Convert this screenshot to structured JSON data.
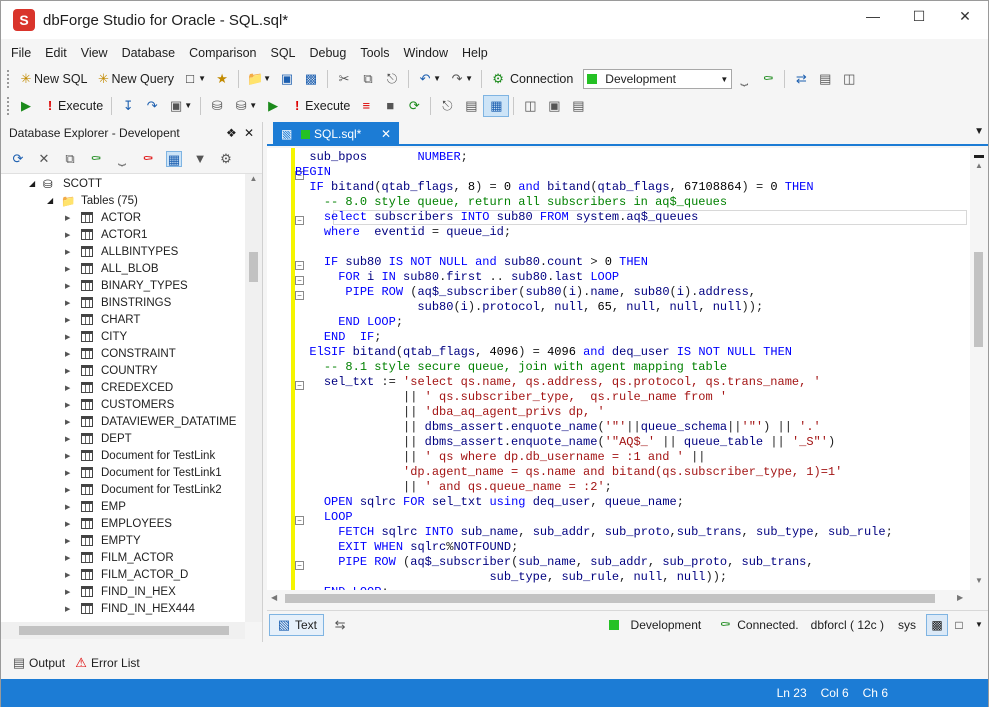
{
  "window": {
    "title": "dbForge Studio for Oracle - SQL.sql*",
    "logo_letter": "S"
  },
  "menu": [
    "File",
    "Edit",
    "View",
    "Database",
    "Comparison",
    "SQL",
    "Debug",
    "Tools",
    "Window",
    "Help"
  ],
  "toolbar1": {
    "new_sql": "New SQL",
    "new_query": "New Query",
    "connection_label": "Connection",
    "connection_value": "Development"
  },
  "toolbar2": {
    "execute": "Execute",
    "execute2": "Execute"
  },
  "explorer": {
    "title": "Database Explorer - Developent",
    "schema": "SCOTT",
    "tables_label": "Tables (75)",
    "tables": [
      "ACTOR",
      "ACTOR1",
      "ALLBINTYPES",
      "ALL_BLOB",
      "BINARY_TYPES",
      "BINSTRINGS",
      "CHART",
      "CITY",
      "CONSTRAINT",
      "COUNTRY",
      "CREDEXCED",
      "CUSTOMERS",
      "DATAVIEWER_DATATIME",
      "DEPT",
      "Document for TestLink",
      "Document for TestLink1",
      "Document for TestLink2",
      "EMP",
      "EMPLOYEES",
      "EMPTY",
      "FILM_ACTOR",
      "FILM_ACTOR_D",
      "FIND_IN_HEX",
      "FIND_IN_HEX444"
    ]
  },
  "doc_tab": {
    "label": "SQL.sql*"
  },
  "code_lines": [
    "  sub_bpos       NUMBER;",
    "BEGIN",
    "  IF bitand(qtab_flags, 8) = 0 and bitand(qtab_flags, 67108864) = 0 THEN",
    "    -- 8.0 style queue, return all subscribers in aq$_queues",
    "    select subscribers INTO sub80 FROM system.aq$_queues",
    "    where  eventid = queue_id;",
    "",
    "    IF sub80 IS NOT NULL and sub80.count > 0 THEN",
    "      FOR i IN sub80.first .. sub80.last LOOP",
    "       PIPE ROW (aq$_subscriber(sub80(i).name, sub80(i).address,",
    "                 sub80(i).protocol, null, 65, null, null, null));",
    "      END LOOP;",
    "    END  IF;",
    "  ElSIF bitand(qtab_flags, 4096) = 4096 and deq_user IS NOT NULL THEN",
    "    -- 8.1 style secure queue, join with agent mapping table",
    "    sel_txt := 'select qs.name, qs.address, qs.protocol, qs.trans_name, '",
    "               || ' qs.subscriber_type,  qs.rule_name from '",
    "               || 'dba_aq_agent_privs dp, '",
    "               || dbms_assert.enquote_name('\"'||queue_schema||'\"') || '.'",
    "               || dbms_assert.enquote_name('\"AQ$_' || queue_table || '_S\"')",
    "               || ' qs where dp.db_username = :1 and ' ||",
    "               'dp.agent_name = qs.name and bitand(qs.subscriber_type, 1)=1'",
    "               || ' and qs.queue_name = :2';",
    "    OPEN sqlrc FOR sel_txt using deq_user, queue_name;",
    "    LOOP",
    "      FETCH sqlrc INTO sub_name, sub_addr, sub_proto,sub_trans, sub_type, sub_rule;",
    "      EXIT WHEN sqlrc%NOTFOUND;",
    "      PIPE ROW (aq$_subscriber(sub_name, sub_addr, sub_proto, sub_trans,",
    "                           sub_type, sub_rule, null, null));",
    "    END LOOP;"
  ],
  "editor_status": {
    "text_btn": "Text",
    "connection": "Development",
    "state": "Connected.",
    "server": "dbforcl ( 12c )",
    "user": "sys"
  },
  "bottom_tabs": {
    "output": "Output",
    "error_list": "Error List"
  },
  "statusbar": {
    "ln": "Ln 23",
    "col": "Col 6",
    "ch": "Ch 6"
  },
  "colors": {
    "accent": "#1c7cd5",
    "connection": "#25c125",
    "modified_margin": "#f5f500"
  }
}
